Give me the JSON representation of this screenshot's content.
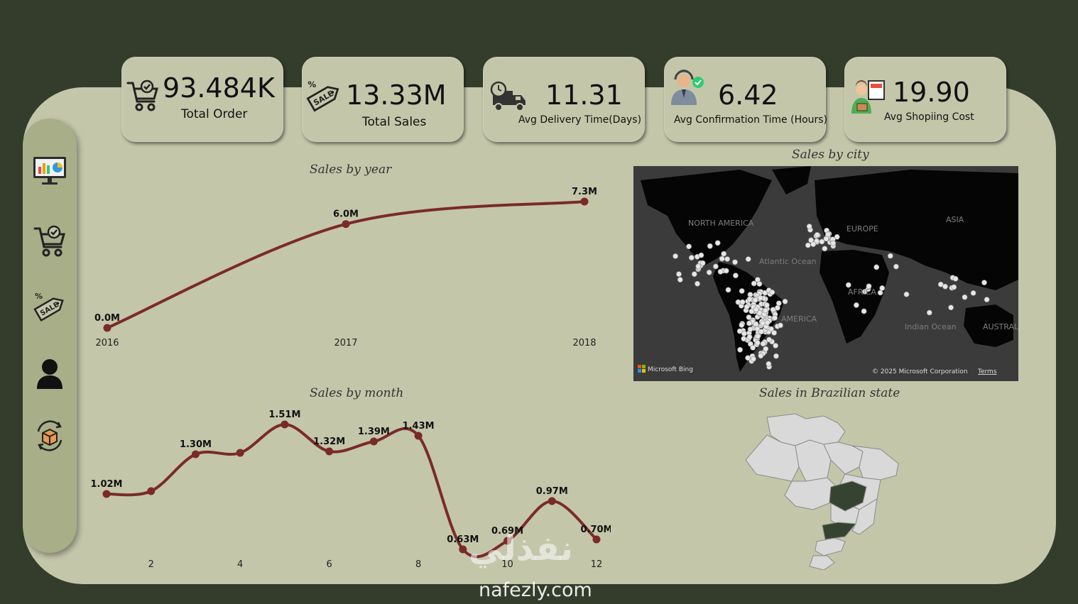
{
  "kpis": [
    {
      "value": "93.484K",
      "label": "Total Order",
      "icon": "cart-check-icon"
    },
    {
      "value": "13.33M",
      "label": "Total Sales",
      "icon": "sale-tag-icon"
    },
    {
      "value": "11.31",
      "label": "Avg Delivery Time(Days)",
      "icon": "delivery-truck-icon"
    },
    {
      "value": "6.42",
      "label": "Avg Confirmation Time (Hours)",
      "icon": "agent-check-icon"
    },
    {
      "value": "19.90",
      "label": "Avg Shopiing Cost",
      "icon": "shopkeeper-icon"
    }
  ],
  "sidebar": {
    "items": [
      {
        "icon": "dashboard-monitor-icon"
      },
      {
        "icon": "cart-check-icon"
      },
      {
        "icon": "sale-tag-icon"
      },
      {
        "icon": "user-icon"
      },
      {
        "icon": "package-return-icon"
      }
    ]
  },
  "charts": {
    "year_title": "Sales by year",
    "month_title": "Sales by month",
    "city_title": "Sales by city",
    "state_title": "Sales in Brazilian state"
  },
  "chart_data": [
    {
      "type": "line",
      "title": "Sales by year",
      "x": [
        2016,
        2017,
        2018
      ],
      "values": [
        0.0,
        6.0,
        7.3
      ],
      "data_labels": [
        "0.0M",
        "6.0M",
        "7.3M"
      ],
      "tick_labels": [
        "2016",
        "2017",
        "2018"
      ],
      "ylim": [
        0,
        7.3
      ],
      "grid": false,
      "color": "#7a2a2a"
    },
    {
      "type": "line",
      "title": "Sales by month",
      "x": [
        1,
        2,
        3,
        4,
        5,
        6,
        7,
        8,
        9,
        10,
        11,
        12
      ],
      "values": [
        1.02,
        1.04,
        1.3,
        1.31,
        1.51,
        1.32,
        1.39,
        1.43,
        0.63,
        0.69,
        0.97,
        0.7
      ],
      "data_labels": [
        "1.02M",
        "",
        "1.30M",
        "",
        "1.51M",
        "1.32M",
        "1.39M",
        "1.43M",
        "0.63M",
        "0.69M",
        "0.97M",
        "0.70M"
      ],
      "tick_labels": [
        "",
        "2",
        "",
        "4",
        "",
        "6",
        "",
        "8",
        "",
        "10",
        "",
        "12"
      ],
      "grid": false,
      "color": "#7a2a2a"
    }
  ],
  "map": {
    "labels": {
      "north_america": "NORTH AMERICA",
      "europe": "EUROPE",
      "asia": "ASIA",
      "atlantic": "Atlantic Ocean",
      "africa": "AFRICA",
      "south_america": "AMERICA",
      "indian": "Indian Ocean",
      "australia": "AUSTRAL"
    },
    "brand": "Microsoft Bing",
    "copyright": "© 2025 Microsoft Corporation",
    "terms": "Terms"
  },
  "watermark": {
    "arabic": "نفذلي",
    "site": "nafezly.com"
  },
  "colors": {
    "background": "#343c2b",
    "panel": "#c4c6aa",
    "sidebar": "#a8ae88",
    "line": "#7a2a2a",
    "highlight_state": "#364330"
  }
}
